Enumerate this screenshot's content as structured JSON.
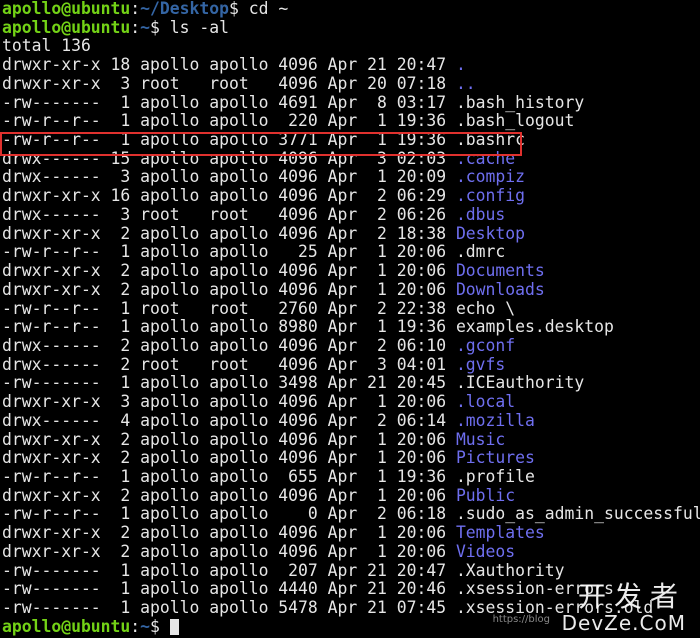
{
  "prompt": {
    "user_host": "apollo@ubuntu",
    "colon": ":",
    "path_desktop": "~/Desktop",
    "path_home": "~",
    "symbol": "$ "
  },
  "commands": {
    "first": "cd ~",
    "second": "ls -al"
  },
  "total": "total 136",
  "entries": [
    {
      "prefix": "drwxr-xr-x 18 apollo apollo 4096 Apr 21 20:47 ",
      "name": ".",
      "type": "dir"
    },
    {
      "prefix": "drwxr-xr-x  3 root   root   4096 Apr 20 07:18 ",
      "name": "..",
      "type": "dir"
    },
    {
      "prefix": "-rw-------  1 apollo apollo 4691 Apr  8 03:17 ",
      "name": ".bash_history",
      "type": "file"
    },
    {
      "prefix": "-rw-r--r--  1 apollo apollo  220 Apr  1 19:36 ",
      "name": ".bash_logout",
      "type": "file"
    },
    {
      "prefix": "-rw-r--r--  1 apollo apollo 3771 Apr  1 19:36 ",
      "name": ".bashrc",
      "type": "file"
    },
    {
      "prefix": "drwx------ 15 apollo apollo 4096 Apr  3 02:03 ",
      "name": ".cache",
      "type": "dir"
    },
    {
      "prefix": "drwx------  3 apollo apollo 4096 Apr  1 20:09 ",
      "name": ".compiz",
      "type": "dir"
    },
    {
      "prefix": "drwxr-xr-x 16 apollo apollo 4096 Apr  2 06:29 ",
      "name": ".config",
      "type": "dir"
    },
    {
      "prefix": "drwx------  3 root   root   4096 Apr  2 06:26 ",
      "name": ".dbus",
      "type": "dir"
    },
    {
      "prefix": "drwxr-xr-x  2 apollo apollo 4096 Apr  2 18:38 ",
      "name": "Desktop",
      "type": "dir"
    },
    {
      "prefix": "-rw-r--r--  1 apollo apollo   25 Apr  1 20:06 ",
      "name": ".dmrc",
      "type": "file"
    },
    {
      "prefix": "drwxr-xr-x  2 apollo apollo 4096 Apr  1 20:06 ",
      "name": "Documents",
      "type": "dir"
    },
    {
      "prefix": "drwxr-xr-x  2 apollo apollo 4096 Apr  1 20:06 ",
      "name": "Downloads",
      "type": "dir"
    },
    {
      "prefix": "-rw-r--r--  1 root   root   2760 Apr  2 22:38 ",
      "name": "echo \\",
      "type": "file"
    },
    {
      "prefix": "-rw-r--r--  1 apollo apollo 8980 Apr  1 19:36 ",
      "name": "examples.desktop",
      "type": "file"
    },
    {
      "prefix": "drwx------  2 apollo apollo 4096 Apr  2 06:10 ",
      "name": ".gconf",
      "type": "dir"
    },
    {
      "prefix": "drwx------  2 root   root   4096 Apr  3 04:01 ",
      "name": ".gvfs",
      "type": "dir"
    },
    {
      "prefix": "-rw-------  1 apollo apollo 3498 Apr 21 20:45 ",
      "name": ".ICEauthority",
      "type": "file"
    },
    {
      "prefix": "drwxr-xr-x  3 apollo apollo 4096 Apr  1 20:06 ",
      "name": ".local",
      "type": "dir"
    },
    {
      "prefix": "drwx------  4 apollo apollo 4096 Apr  2 06:14 ",
      "name": ".mozilla",
      "type": "dir"
    },
    {
      "prefix": "drwxr-xr-x  2 apollo apollo 4096 Apr  1 20:06 ",
      "name": "Music",
      "type": "dir"
    },
    {
      "prefix": "drwxr-xr-x  2 apollo apollo 4096 Apr  1 20:06 ",
      "name": "Pictures",
      "type": "dir"
    },
    {
      "prefix": "-rw-r--r--  1 apollo apollo  655 Apr  1 19:36 ",
      "name": ".profile",
      "type": "file"
    },
    {
      "prefix": "drwxr-xr-x  2 apollo apollo 4096 Apr  1 20:06 ",
      "name": "Public",
      "type": "dir"
    },
    {
      "prefix": "-rw-r--r--  1 apollo apollo    0 Apr  2 06:18 ",
      "name": ".sudo_as_admin_successful",
      "type": "file"
    },
    {
      "prefix": "drwxr-xr-x  2 apollo apollo 4096 Apr  1 20:06 ",
      "name": "Templates",
      "type": "dir"
    },
    {
      "prefix": "drwxr-xr-x  2 apollo apollo 4096 Apr  1 20:06 ",
      "name": "Videos",
      "type": "dir"
    },
    {
      "prefix": "-rw-------  1 apollo apollo  207 Apr 21 20:47 ",
      "name": ".Xauthority",
      "type": "file"
    },
    {
      "prefix": "-rw-------  1 apollo apollo 4440 Apr 21 20:46 ",
      "name": ".xsession-errors",
      "type": "file"
    },
    {
      "prefix": "-rw-------  1 apollo apollo 5478 Apr 21 07:45 ",
      "name": ".xsession-errors.old",
      "type": "file"
    }
  ],
  "watermark": {
    "cn": "开发者",
    "en": "DevZe.CoM",
    "small": "https://blog"
  },
  "colors": {
    "background": "#000000",
    "text": "#e6e6e6",
    "prompt_user": "#73d216",
    "prompt_path": "#3465a4",
    "directory": "#6f6ff0",
    "highlight_border": "#e0312e"
  }
}
